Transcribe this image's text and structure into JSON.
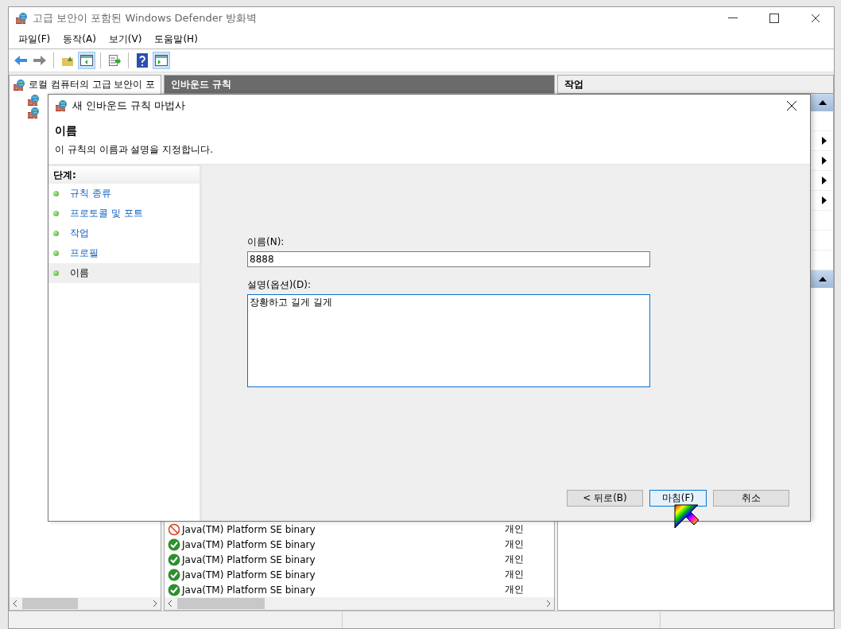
{
  "window": {
    "title": "고급 보안이 포함된 Windows Defender 방화벽"
  },
  "menu": [
    "파일(F)",
    "동작(A)",
    "보기(V)",
    "도움말(H)"
  ],
  "toolbar": [
    {
      "kind": "back",
      "pressed": false
    },
    {
      "kind": "forward",
      "pressed": false
    },
    {
      "kind": "separator"
    },
    {
      "kind": "up",
      "pressed": false
    },
    {
      "kind": "tree",
      "pressed": true
    },
    {
      "kind": "separator"
    },
    {
      "kind": "export",
      "pressed": false
    },
    {
      "kind": "separator"
    },
    {
      "kind": "help",
      "pressed": false
    },
    {
      "kind": "action",
      "pressed": true
    }
  ],
  "tree": {
    "root": "로컬 컴퓨터의 고급 보안이 포"
  },
  "rules_pane": {
    "title": "인바운드 규칙",
    "rows": [
      {
        "name": "Java(TM) Platform SE binary",
        "profile": "개인",
        "kind": "block"
      },
      {
        "name": "Java(TM) Platform SE binary",
        "profile": "개인",
        "kind": "allow"
      },
      {
        "name": "Java(TM) Platform SE binary",
        "profile": "개인",
        "kind": "allow"
      },
      {
        "name": "Java(TM) Platform SE binary",
        "profile": "개인",
        "kind": "allow"
      },
      {
        "name": "Java(TM) Platform SE binary",
        "profile": "개인",
        "kind": "allow"
      }
    ]
  },
  "actions_pane": {
    "title": "작업"
  },
  "dialog": {
    "title": "새 인바운드 규칙 마법사",
    "heading": "이름",
    "subtitle": "이 규칙의 이름과 설명을 지정합니다.",
    "steps_title": "단계:",
    "steps": [
      {
        "label": "규칙 종류",
        "selected": false
      },
      {
        "label": "프로토콜 및 포트",
        "selected": false
      },
      {
        "label": "작업",
        "selected": false
      },
      {
        "label": "프로필",
        "selected": false
      },
      {
        "label": "이름",
        "selected": true
      }
    ],
    "name_label": "이름(N):",
    "name_value": "8888",
    "description_label": "설명(옵션)(D):",
    "description_value": "장황하고 길게 길게",
    "buttons": [
      {
        "label": "< 뒤로(B)",
        "focused": false
      },
      {
        "label": "마침(F)",
        "focused": true
      },
      {
        "label": "취소",
        "focused": false
      }
    ]
  }
}
